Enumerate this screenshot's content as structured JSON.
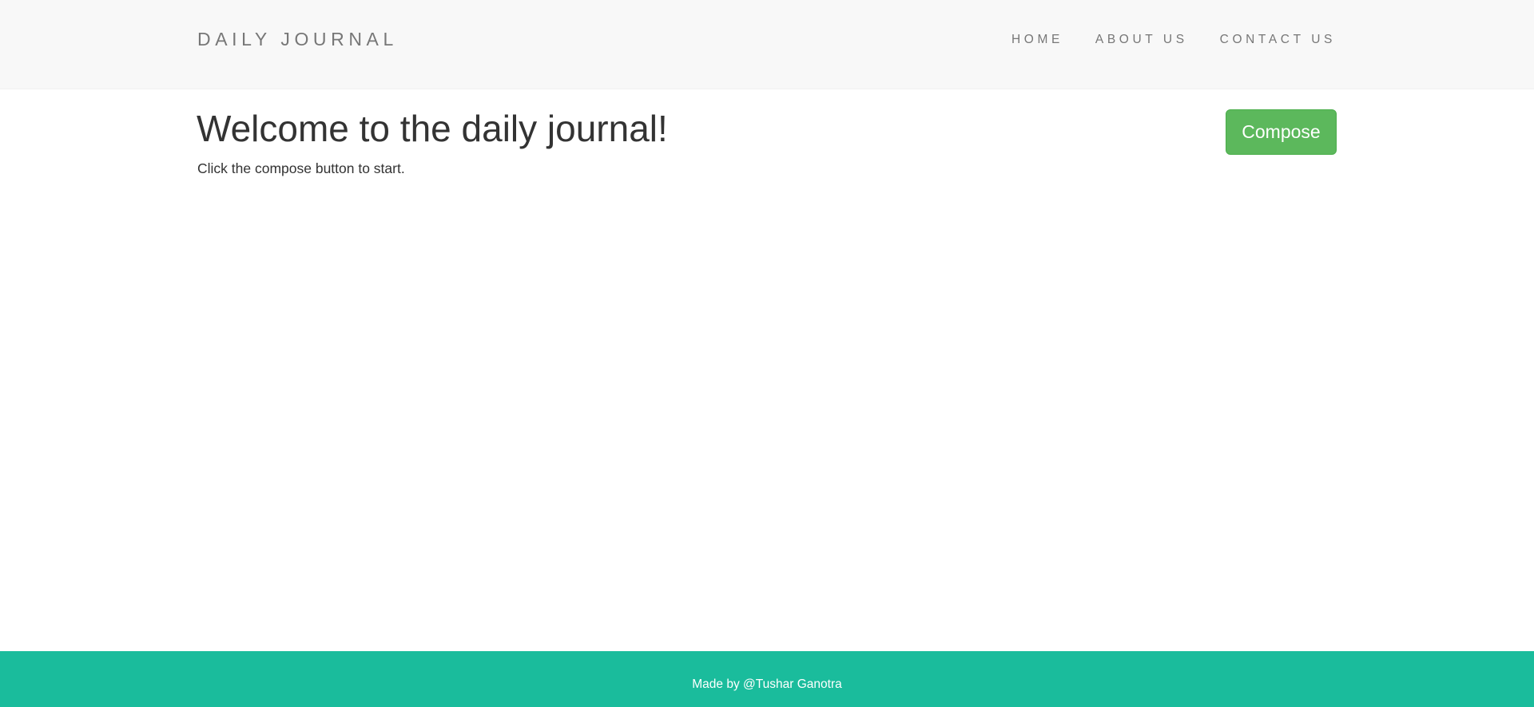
{
  "header": {
    "brand": "DAILY JOURNAL",
    "nav": [
      {
        "label": "HOME"
      },
      {
        "label": "ABOUT US"
      },
      {
        "label": "CONTACT US"
      }
    ]
  },
  "main": {
    "heading": "Welcome to the daily journal!",
    "subtext": "Click the compose button to start.",
    "compose_label": "Compose"
  },
  "footer": {
    "text": "Made by @Tushar Ganotra"
  },
  "colors": {
    "navbar_bg": "#f8f8f8",
    "compose_green": "#5cb85c",
    "footer_teal": "#1abc9c"
  }
}
